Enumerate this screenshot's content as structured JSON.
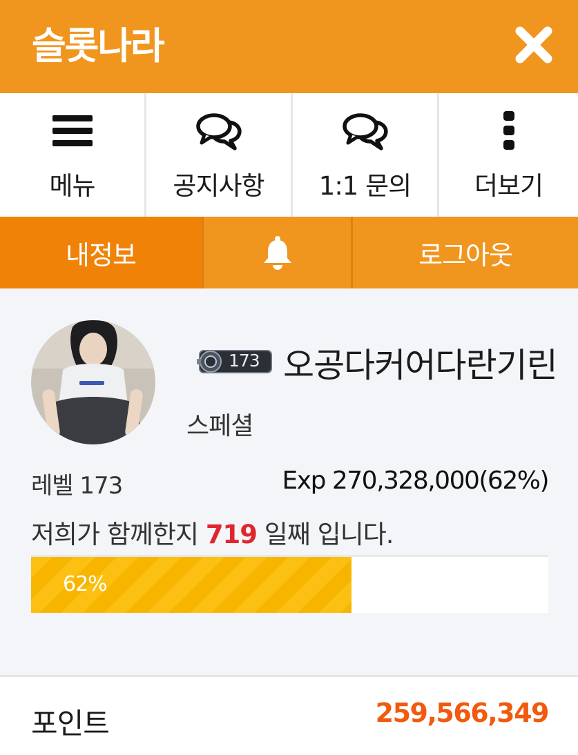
{
  "header": {
    "title": "슬롯나라",
    "close_icon": "close-icon"
  },
  "quicknav": {
    "items": [
      {
        "label": "메뉴",
        "icon": "hamburger-menu-icon"
      },
      {
        "label": "공지사항",
        "icon": "chat-bubbles-icon"
      },
      {
        "label": "1:1 문의",
        "icon": "chat-bubbles-icon"
      },
      {
        "label": "더보기",
        "icon": "more-vertical-icon"
      }
    ]
  },
  "tabs": {
    "my_info": "내정보",
    "notifications_icon": "bell-icon",
    "logout": "로그아웃"
  },
  "profile": {
    "badge_level": "173",
    "nickname": "오공다커어다란기린",
    "grade": "스페셜",
    "level_label": "레벨 173",
    "exp_label": "Exp 270,328,000(62%)",
    "together_prefix": "저희가 함께한지 ",
    "together_days": "719",
    "together_suffix": " 일째 입니다.",
    "progress_percent": 62,
    "progress_label": "62%"
  },
  "points": {
    "label": "포인트",
    "value": "259,566,349"
  },
  "colors": {
    "header": "#f0961f",
    "tab_active": "#f08207",
    "points_value": "#f15a0e",
    "days_highlight": "#e0262d",
    "progress": "#fbc012"
  }
}
